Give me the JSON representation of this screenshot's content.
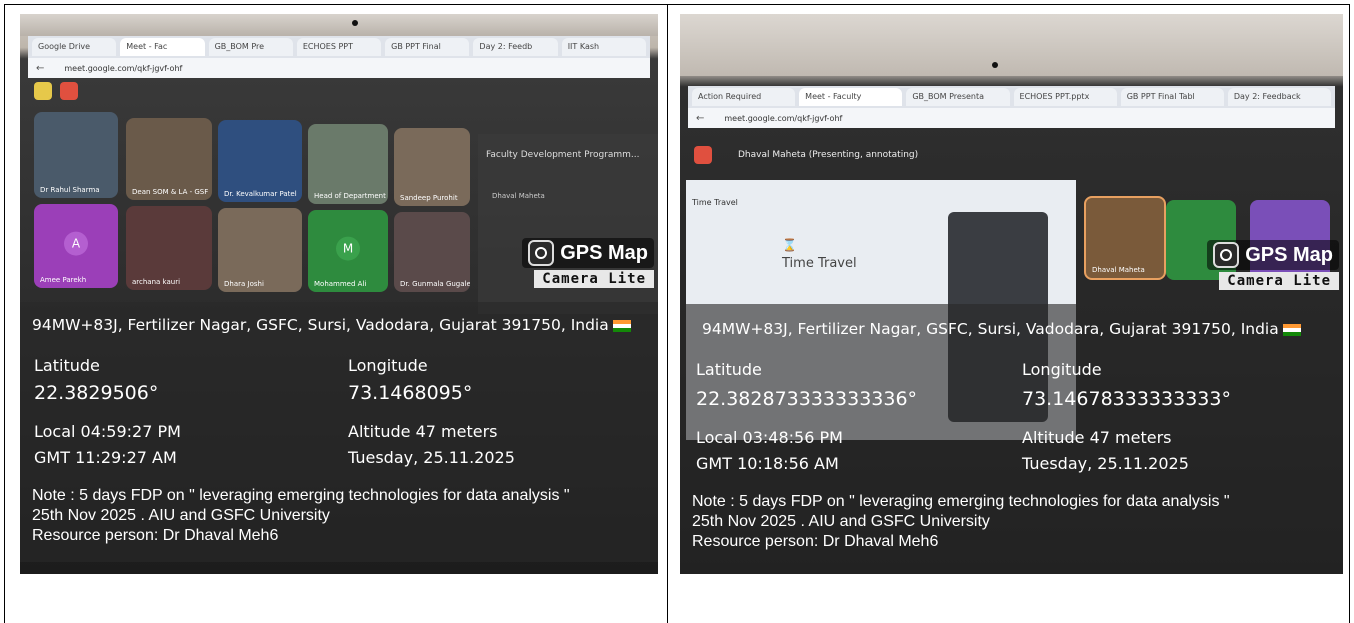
{
  "photos": [
    {
      "id": "left",
      "browser": {
        "tabs": [
          "Google Drive",
          "Meet - Fac",
          "GB_BOM Pre",
          "ECHOES PPT",
          "GB PPT Final",
          "Day 2: Feedb",
          "IIT Kash"
        ],
        "url": "meet.google.com/qkf-jgvf-ohf"
      },
      "meet": {
        "tiles": [
          {
            "name": "Dr Rahul Sharma",
            "color": "#4a5a6a"
          },
          {
            "name": "Dean SOM & LA - GSF",
            "color": "#6a5a4a"
          },
          {
            "name": "Dr. Kevalkumar Patel",
            "color": "#2f4f7f"
          },
          {
            "name": "Head of Department",
            "color": "#6a7a6a"
          },
          {
            "name": "Sandeep Purohit",
            "color": "#7a6a5a"
          },
          {
            "name": "Amee Parekh",
            "color": "#9b3fb8",
            "initial": "A"
          },
          {
            "name": "archana kauri",
            "color": "#5a3a3a"
          },
          {
            "name": "Dhara Joshi",
            "color": "#7a6a5a"
          },
          {
            "name": "Mohammed Ali",
            "color": "#2e8b3e",
            "initial": "M"
          },
          {
            "name": "Dr. Gunmala Gugale",
            "color": "#5a4a4a"
          }
        ],
        "panel_title": "Faculty Development Programm...",
        "panel_sender": "Dhaval Maheta"
      },
      "overlay": {
        "gps_title": "GPS Map",
        "gps_sub": "Camera Lite",
        "address": "94MW+83J, Fertilizer Nagar, GSFC, Sursi, Vadodara, Gujarat 391750, India",
        "latitude_label": "Latitude",
        "latitude_value": "22.3829506°",
        "longitude_label": "Longitude",
        "longitude_value": "73.1468095°",
        "local_time": "Local 04:59:27 PM",
        "gmt_time": "GMT 11:29:27 AM",
        "altitude": "Altitude 47 meters",
        "date": "Tuesday, 25.11.2025",
        "note_line1": "Note : 5 days FDP on \" leveraging emerging technologies for data analysis \"",
        "note_line2": "25th Nov 2025 . AIU and GSFC University",
        "note_line3": "Resource person: Dr Dhaval Meh6"
      }
    },
    {
      "id": "right",
      "browser": {
        "tabs": [
          "Action Required",
          "Meet - Faculty",
          "GB_BOM Presenta",
          "ECHOES PPT.pptx",
          "GB PPT Final Tabl",
          "Day 2: Feedback"
        ],
        "url": "meet.google.com/qkf-jgvf-ohf"
      },
      "meet": {
        "presenter_banner": "Dhaval Maheta (Presenting, annotating)",
        "presenter_tile": "Dhaval Maheta",
        "slide_title": "Time Travel",
        "doc_title": "Time Travel"
      },
      "overlay": {
        "gps_title": "GPS Map",
        "gps_sub": "Camera Lite",
        "address": "94MW+83J, Fertilizer Nagar, GSFC, Sursi, Vadodara, Gujarat 391750, India",
        "latitude_label": "Latitude",
        "latitude_value": "22.382873333333336°",
        "longitude_label": "Longitude",
        "longitude_value": "73.14678333333333°",
        "local_time": "Local 03:48:56 PM",
        "gmt_time": "GMT 10:18:56 AM",
        "altitude": "Altitude 47 meters",
        "date": "Tuesday, 25.11.2025",
        "note_line1": "Note : 5 days FDP on \" leveraging emerging technologies for data analysis \"",
        "note_line2": "25th Nov 2025 . AIU and GSFC University",
        "note_line3": "Resource person: Dr Dhaval Meh6"
      }
    }
  ],
  "colors": {
    "overlay_bg": "#282828",
    "flag_saffron": "#ff9933",
    "flag_green": "#138808"
  }
}
